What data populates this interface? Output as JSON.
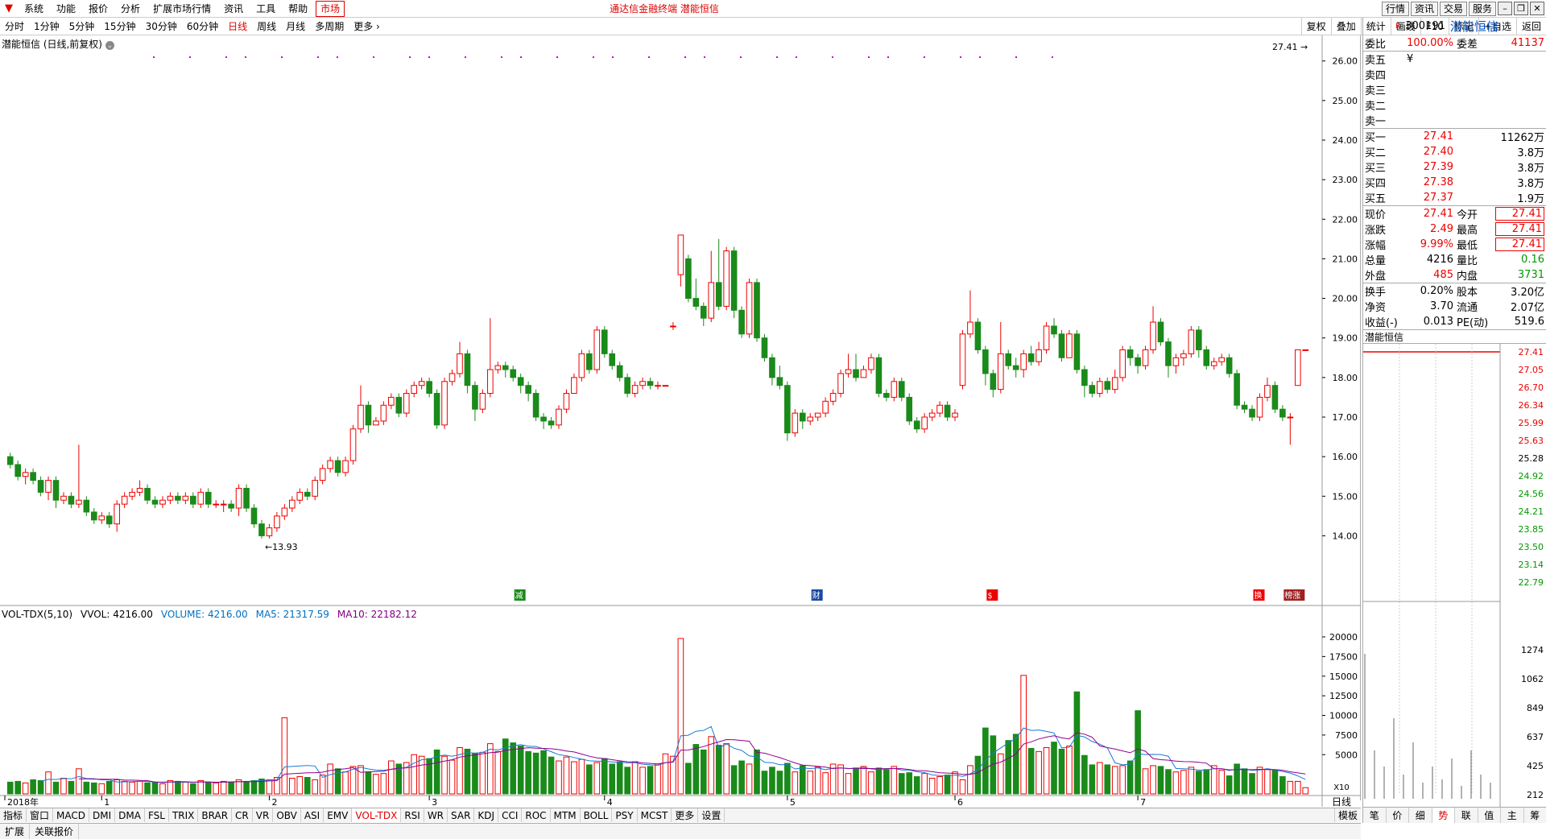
{
  "menubar": {
    "items": [
      "系统",
      "功能",
      "报价",
      "分析",
      "扩展市场行情",
      "资讯",
      "工具",
      "帮助"
    ],
    "market": "市场",
    "center_title": "通达信金融终端  潜能恒信",
    "quote_buttons": [
      "行情",
      "资讯",
      "交易",
      "服务"
    ]
  },
  "toolbar": {
    "periods": [
      "分时",
      "1分钟",
      "5分钟",
      "15分钟",
      "30分钟",
      "60分钟",
      "日线",
      "周线",
      "月线",
      "多周期",
      "更多 ›"
    ],
    "active_period": "日线",
    "right_tools": [
      "复权",
      "叠加",
      "统计",
      "画线",
      "F10",
      "标记",
      "+自选",
      "返回"
    ]
  },
  "chart": {
    "title": "潜能恒信 (日线,前复权)",
    "price_axis": [
      "26.00",
      "25.00",
      "24.00",
      "23.00",
      "22.00",
      "21.00",
      "20.00",
      "19.00",
      "18.00",
      "17.00",
      "16.00",
      "15.00",
      "14.00"
    ],
    "low_annotation": "13.93",
    "high_annotation": "27.41",
    "markers": [
      "减",
      "财",
      "$",
      "换",
      "榜涨"
    ],
    "volume_title": "VOL-TDX(5,10)",
    "volume_vvol": "VVOL: 4216.00",
    "volume_value": "VOLUME: 4216.00",
    "volume_ma5": "MA5: 21317.59",
    "volume_ma10": "MA10: 22182.12",
    "volume_axis": [
      "20000",
      "17500",
      "15000",
      "12500",
      "10000",
      "7500",
      "5000"
    ],
    "volume_unit": "X10",
    "x_labels": [
      "2018年",
      "1",
      "2",
      "3",
      "4",
      "5",
      "6",
      "7"
    ],
    "period_label": "日线"
  },
  "chart_data": {
    "type": "candlestick",
    "ylim": [
      13.5,
      27.5
    ],
    "volume_ylim": [
      0,
      20000
    ],
    "candles": [
      [
        16.0,
        15.8,
        16.1,
        15.7
      ],
      [
        15.8,
        15.5,
        15.9,
        15.4
      ],
      [
        15.5,
        15.6,
        15.7,
        15.3
      ],
      [
        15.6,
        15.4,
        15.7,
        15.3
      ],
      [
        15.4,
        15.1,
        15.5,
        15.0
      ],
      [
        15.1,
        15.4,
        15.5,
        14.9
      ],
      [
        15.4,
        14.9,
        15.5,
        14.7
      ],
      [
        14.9,
        15.0,
        15.1,
        14.8
      ],
      [
        15.0,
        14.8,
        15.1,
        14.7
      ],
      [
        14.8,
        14.9,
        16.3,
        14.7
      ],
      [
        14.9,
        14.6,
        15.0,
        14.5
      ],
      [
        14.6,
        14.4,
        14.7,
        14.3
      ],
      [
        14.4,
        14.5,
        14.6,
        14.3
      ],
      [
        14.5,
        14.3,
        14.6,
        14.2
      ],
      [
        14.3,
        14.8,
        14.9,
        14.1
      ],
      [
        14.8,
        15.0,
        15.1,
        14.7
      ],
      [
        15.0,
        15.1,
        15.2,
        14.9
      ],
      [
        15.1,
        15.2,
        15.4,
        15.0
      ],
      [
        15.2,
        14.9,
        15.3,
        14.8
      ],
      [
        14.9,
        14.8,
        15.0,
        14.7
      ],
      [
        14.8,
        14.9,
        15.0,
        14.7
      ],
      [
        14.9,
        15.0,
        15.1,
        14.8
      ],
      [
        15.0,
        14.9,
        15.1,
        14.8
      ],
      [
        14.9,
        15.0,
        15.1,
        14.8
      ],
      [
        15.0,
        14.8,
        15.1,
        14.7
      ],
      [
        14.8,
        15.1,
        15.2,
        14.7
      ],
      [
        15.1,
        14.8,
        15.2,
        14.7
      ],
      [
        14.8,
        14.8,
        14.9,
        14.7
      ],
      [
        14.8,
        14.8,
        14.9,
        14.6
      ],
      [
        14.8,
        14.7,
        14.9,
        14.6
      ],
      [
        14.7,
        15.2,
        15.3,
        14.5
      ],
      [
        15.2,
        14.7,
        15.3,
        14.6
      ],
      [
        14.7,
        14.3,
        14.8,
        14.2
      ],
      [
        14.3,
        14.0,
        14.4,
        13.93
      ],
      [
        14.0,
        14.2,
        14.3,
        13.93
      ],
      [
        14.2,
        14.5,
        14.6,
        14.1
      ],
      [
        14.5,
        14.7,
        14.8,
        14.4
      ],
      [
        14.7,
        14.9,
        15.0,
        14.6
      ],
      [
        14.9,
        15.1,
        15.2,
        14.8
      ],
      [
        15.1,
        15.0,
        15.2,
        14.9
      ],
      [
        15.0,
        15.4,
        15.5,
        14.9
      ],
      [
        15.4,
        15.7,
        15.8,
        15.3
      ],
      [
        15.7,
        15.9,
        16.0,
        15.6
      ],
      [
        15.9,
        15.6,
        16.0,
        15.5
      ],
      [
        15.6,
        15.9,
        16.0,
        15.5
      ],
      [
        15.9,
        16.7,
        16.8,
        15.8
      ],
      [
        16.7,
        17.3,
        17.8,
        16.6
      ],
      [
        17.3,
        16.8,
        17.4,
        16.6
      ],
      [
        16.8,
        16.9,
        17.0,
        16.8
      ],
      [
        16.9,
        17.3,
        17.4,
        16.8
      ],
      [
        17.3,
        17.5,
        17.6,
        17.2
      ],
      [
        17.5,
        17.1,
        17.6,
        17.0
      ],
      [
        17.1,
        17.6,
        17.7,
        17.0
      ],
      [
        17.6,
        17.8,
        17.9,
        17.5
      ],
      [
        17.8,
        17.9,
        18.0,
        17.7
      ],
      [
        17.9,
        17.6,
        18.0,
        17.5
      ],
      [
        17.6,
        16.8,
        17.7,
        16.7
      ],
      [
        16.8,
        17.9,
        18.0,
        16.7
      ],
      [
        17.9,
        18.1,
        18.2,
        17.8
      ],
      [
        18.1,
        18.6,
        18.9,
        18.0
      ],
      [
        18.6,
        17.8,
        18.7,
        17.6
      ],
      [
        17.8,
        17.2,
        17.9,
        16.9
      ],
      [
        17.2,
        17.6,
        17.7,
        17.1
      ],
      [
        17.6,
        18.2,
        19.5,
        17.5
      ],
      [
        18.2,
        18.3,
        18.4,
        18.1
      ],
      [
        18.3,
        18.2,
        18.4,
        18.0
      ],
      [
        18.2,
        18.0,
        18.3,
        17.9
      ],
      [
        18.0,
        17.8,
        18.1,
        17.6
      ],
      [
        17.8,
        17.6,
        17.9,
        17.4
      ],
      [
        17.6,
        17.0,
        17.7,
        16.9
      ],
      [
        17.0,
        16.9,
        17.1,
        16.7
      ],
      [
        16.9,
        16.8,
        17.0,
        16.7
      ],
      [
        16.8,
        17.2,
        17.3,
        16.7
      ],
      [
        17.2,
        17.6,
        17.7,
        17.1
      ],
      [
        17.6,
        18.0,
        18.1,
        17.8
      ],
      [
        18.0,
        18.6,
        18.7,
        17.9
      ],
      [
        18.6,
        18.2,
        18.7,
        18.1
      ],
      [
        18.2,
        19.2,
        19.3,
        18.1
      ],
      [
        19.2,
        18.6,
        19.3,
        18.5
      ],
      [
        18.6,
        18.3,
        18.7,
        18.2
      ],
      [
        18.3,
        18.0,
        18.4,
        17.9
      ],
      [
        18.0,
        17.6,
        18.1,
        17.5
      ],
      [
        17.6,
        17.8,
        17.9,
        17.5
      ],
      [
        17.8,
        17.9,
        18.0,
        17.7
      ],
      [
        17.9,
        17.8,
        18.0,
        17.7
      ],
      [
        17.8,
        17.8,
        17.9,
        17.7
      ],
      [
        17.8,
        17.8,
        17.8,
        17.8
      ],
      [
        19.3,
        19.3,
        19.4,
        19.2
      ],
      [
        20.6,
        21.6,
        21.6,
        20.3
      ],
      [
        21.0,
        20.0,
        21.1,
        19.9
      ],
      [
        20.0,
        19.8,
        20.5,
        19.7
      ],
      [
        19.8,
        19.5,
        19.9,
        19.3
      ],
      [
        19.5,
        20.4,
        21.2,
        19.4
      ],
      [
        20.4,
        19.8,
        21.5,
        19.7
      ],
      [
        19.8,
        21.2,
        21.3,
        19.7
      ],
      [
        21.2,
        19.7,
        21.3,
        19.5
      ],
      [
        19.7,
        19.1,
        19.8,
        19.0
      ],
      [
        19.1,
        20.4,
        20.5,
        19.0
      ],
      [
        20.4,
        19.0,
        20.5,
        18.9
      ],
      [
        19.0,
        18.5,
        19.1,
        18.4
      ],
      [
        18.5,
        18.0,
        18.6,
        17.8
      ],
      [
        18.0,
        17.8,
        18.3,
        17.7
      ],
      [
        17.8,
        16.6,
        17.9,
        16.4
      ],
      [
        16.6,
        17.1,
        17.2,
        16.5
      ],
      [
        17.1,
        16.9,
        17.2,
        16.7
      ],
      [
        16.9,
        17.0,
        17.1,
        16.8
      ],
      [
        17.0,
        17.1,
        17.1,
        16.9
      ],
      [
        17.1,
        17.4,
        17.5,
        17.0
      ],
      [
        17.4,
        17.6,
        17.7,
        17.3
      ],
      [
        17.6,
        18.1,
        18.2,
        17.5
      ],
      [
        18.1,
        18.2,
        18.6,
        18.0
      ],
      [
        18.2,
        18.0,
        18.6,
        17.9
      ],
      [
        18.0,
        18.2,
        18.3,
        18.0
      ],
      [
        18.2,
        18.5,
        18.6,
        18.1
      ],
      [
        18.5,
        17.6,
        18.6,
        17.5
      ],
      [
        17.6,
        17.5,
        17.7,
        17.4
      ],
      [
        17.5,
        17.9,
        18.0,
        17.4
      ],
      [
        17.9,
        17.5,
        18.0,
        17.4
      ],
      [
        17.5,
        16.9,
        17.6,
        16.8
      ],
      [
        16.9,
        16.7,
        17.0,
        16.6
      ],
      [
        16.7,
        17.0,
        17.1,
        16.6
      ],
      [
        17.0,
        17.1,
        17.2,
        16.9
      ],
      [
        17.1,
        17.3,
        17.4,
        17.0
      ],
      [
        17.3,
        17.0,
        17.4,
        16.9
      ],
      [
        17.0,
        17.1,
        17.2,
        16.9
      ],
      [
        17.8,
        19.1,
        19.2,
        17.7
      ],
      [
        19.1,
        19.4,
        20.2,
        19.0
      ],
      [
        19.4,
        18.7,
        19.5,
        18.6
      ],
      [
        18.7,
        18.1,
        18.8,
        17.8
      ],
      [
        18.1,
        17.7,
        18.2,
        17.5
      ],
      [
        17.7,
        18.6,
        19.4,
        17.6
      ],
      [
        18.6,
        18.3,
        18.7,
        18.2
      ],
      [
        18.3,
        18.2,
        18.5,
        18.0
      ],
      [
        18.2,
        18.6,
        18.7,
        18.0
      ],
      [
        18.6,
        18.4,
        18.8,
        18.3
      ],
      [
        18.4,
        18.7,
        18.9,
        18.3
      ],
      [
        18.7,
        19.3,
        19.4,
        18.6
      ],
      [
        19.3,
        19.1,
        19.5,
        19.0
      ],
      [
        19.1,
        18.5,
        19.2,
        18.4
      ],
      [
        18.5,
        19.1,
        19.2,
        18.5
      ],
      [
        19.1,
        18.2,
        19.2,
        18.1
      ],
      [
        18.2,
        17.8,
        18.3,
        17.5
      ],
      [
        17.8,
        17.6,
        17.9,
        17.5
      ],
      [
        17.6,
        17.9,
        18.0,
        17.5
      ],
      [
        17.9,
        17.7,
        18.0,
        17.6
      ],
      [
        17.7,
        18.0,
        18.2,
        17.6
      ],
      [
        18.0,
        18.7,
        18.8,
        17.9
      ],
      [
        18.7,
        18.5,
        18.8,
        18.3
      ],
      [
        18.5,
        18.3,
        18.6,
        18.1
      ],
      [
        18.3,
        18.7,
        18.8,
        18.2
      ],
      [
        18.7,
        19.4,
        19.8,
        18.6
      ],
      [
        19.4,
        18.9,
        19.5,
        18.8
      ],
      [
        18.9,
        18.3,
        19.0,
        18.0
      ],
      [
        18.3,
        18.5,
        18.6,
        18.1
      ],
      [
        18.5,
        18.6,
        18.7,
        18.3
      ],
      [
        18.6,
        19.2,
        19.3,
        18.5
      ],
      [
        19.2,
        18.7,
        19.3,
        18.5
      ],
      [
        18.7,
        18.3,
        18.8,
        18.2
      ],
      [
        18.3,
        18.4,
        18.5,
        18.2
      ],
      [
        18.4,
        18.5,
        18.6,
        18.3
      ],
      [
        18.5,
        18.1,
        18.6,
        18.0
      ],
      [
        18.1,
        17.3,
        18.2,
        17.2
      ],
      [
        17.3,
        17.2,
        17.4,
        17.1
      ],
      [
        17.2,
        17.0,
        17.3,
        16.9
      ],
      [
        17.0,
        17.5,
        17.6,
        16.9
      ],
      [
        17.5,
        17.8,
        18.0,
        17.4
      ],
      [
        17.8,
        17.2,
        17.9,
        17.1
      ],
      [
        17.2,
        17.0,
        17.3,
        16.9
      ],
      [
        17.0,
        17.0,
        17.1,
        16.3
      ],
      [
        17.8,
        18.7,
        18.7,
        17.8
      ],
      [
        18.7,
        18.7,
        18.7,
        18.7
      ]
    ],
    "volumes": [
      1500,
      1600,
      1400,
      1800,
      1700,
      2800,
      1500,
      2000,
      1600,
      3200,
      1500,
      1400,
      1300,
      1600,
      1800,
      1600,
      1500,
      1600,
      1400,
      1500,
      1300,
      1700,
      1600,
      1500,
      1300,
      1700,
      1500,
      1400,
      1600,
      1500,
      1800,
      1600,
      1700,
      1900,
      1800,
      2100,
      1900,
      2000,
      2200,
      2100,
      1800,
      2400,
      3800,
      3200,
      2800,
      3500,
      3600,
      2800,
      2500,
      2600,
      4200,
      3800,
      4000,
      5000,
      4800,
      4500,
      5600,
      4800,
      4300,
      5900,
      5700,
      5200,
      5300,
      6400,
      5400,
      7000,
      6500,
      6100,
      5400,
      5200,
      5500,
      4700,
      4200,
      4700,
      4100,
      4400,
      3700,
      4000,
      4500,
      3800,
      4100,
      3400,
      4100,
      3400,
      3500,
      3800,
      5100,
      4800,
      5600,
      3900,
      6300,
      5600,
      7300,
      6200,
      6400,
      3600,
      4200,
      3800,
      5600,
      2900,
      3400,
      2900,
      3900,
      2800,
      3600,
      2900,
      3400,
      2700,
      3800,
      3700,
      2600,
      3300,
      3500,
      2800,
      3300,
      3100,
      3500,
      2600,
      2700,
      2200,
      2600,
      2000,
      2200,
      2400,
      2800,
      1800,
      3600,
      4800,
      4000,
      7400,
      5100,
      6800,
      7600,
      6400,
      5800,
      5400,
      5900,
      6600,
      5700,
      6100,
      5000,
      4900,
      3700,
      4000,
      3700,
      3500,
      3600,
      4200,
      4600,
      3200,
      3600,
      3500,
      3100,
      2800,
      3000,
      3400,
      2900,
      3100,
      3600,
      3000,
      2300,
      3800,
      3200,
      2600,
      3400,
      3100,
      3000,
      2200,
      1600,
      1600,
      800
    ],
    "volume_colors_note": "red=up day, green=down day",
    "special_days": {
      "highlight_high_red": [
        88
      ],
      "big_volume": {
        "88": 19800,
        "128": 8400,
        "140": 13000,
        "133": 15100,
        "36": 9700,
        "148": 10600
      }
    }
  },
  "quote": {
    "code": "300191",
    "name": "潜能恒信",
    "r_badge": "R",
    "commission_ratio_label": "委比",
    "commission_ratio": "100.00%",
    "commission_diff_label": "委差",
    "commission_diff": "41137",
    "asks": [
      {
        "label": "卖五",
        "price": "¥",
        "vol": ""
      },
      {
        "label": "卖四",
        "price": "",
        "vol": ""
      },
      {
        "label": "卖三",
        "price": "",
        "vol": ""
      },
      {
        "label": "卖二",
        "price": "",
        "vol": ""
      },
      {
        "label": "卖一",
        "price": "",
        "vol": ""
      }
    ],
    "bids": [
      {
        "label": "买一",
        "price": "27.41",
        "vol": "11262万"
      },
      {
        "label": "买二",
        "price": "27.40",
        "vol": "3.8万"
      },
      {
        "label": "买三",
        "price": "27.39",
        "vol": "3.8万"
      },
      {
        "label": "买四",
        "price": "27.38",
        "vol": "3.8万"
      },
      {
        "label": "买五",
        "price": "27.37",
        "vol": "1.9万"
      }
    ],
    "stats": [
      {
        "l1": "现价",
        "v1": "27.41",
        "c1": "red",
        "l2": "今开",
        "v2": "27.41",
        "c2": "red"
      },
      {
        "l1": "涨跌",
        "v1": "2.49",
        "c1": "red",
        "l2": "最高",
        "v2": "27.41",
        "c2": "red"
      },
      {
        "l1": "涨幅",
        "v1": "9.99%",
        "c1": "red",
        "l2": "最低",
        "v2": "27.41",
        "c2": "red"
      },
      {
        "l1": "总量",
        "v1": "4216",
        "c1": "",
        "l2": "量比",
        "v2": "0.16",
        "c2": "green"
      },
      {
        "l1": "外盘",
        "v1": "485",
        "c1": "red",
        "l2": "内盘",
        "v2": "3731",
        "c2": "green"
      }
    ],
    "stats2": [
      {
        "l1": "换手",
        "v1": "0.20%",
        "l2": "股本",
        "v2": "3.20亿"
      },
      {
        "l1": "净资",
        "v1": "3.70",
        "l2": "流通",
        "v2": "2.07亿"
      },
      {
        "l1": "收益(-)",
        "v1": "0.013",
        "l2": "PE(动)",
        "v2": "519.6"
      }
    ],
    "mini_title": "潜能恒信",
    "mini_price_axis": [
      "27.41",
      "27.05",
      "26.70",
      "26.34",
      "25.99",
      "25.63",
      "25.28",
      "24.92",
      "24.56",
      "24.21",
      "23.85",
      "23.50",
      "23.14",
      "22.79"
    ],
    "mini_vol_axis": [
      "1274",
      "1062",
      "849",
      "637",
      "425",
      "212"
    ],
    "mini_tabs": [
      "笔",
      "价",
      "细",
      "势",
      "联",
      "值",
      "主",
      "筹"
    ],
    "mini_active": "势"
  },
  "bottom": {
    "tabs": [
      "指标",
      "窗口",
      "MACD",
      "DMI",
      "DMA",
      "FSL",
      "TRIX",
      "BRAR",
      "CR",
      "VR",
      "OBV",
      "ASI",
      "EMV",
      "VOL-TDX",
      "RSI",
      "WR",
      "SAR",
      "KDJ",
      "CCI",
      "ROC",
      "MTM",
      "BOLL",
      "PSY",
      "MCST",
      "更多",
      "设置"
    ],
    "active_tab": "VOL-TDX",
    "template": "模板",
    "status": [
      "扩展",
      "关联报价"
    ]
  }
}
